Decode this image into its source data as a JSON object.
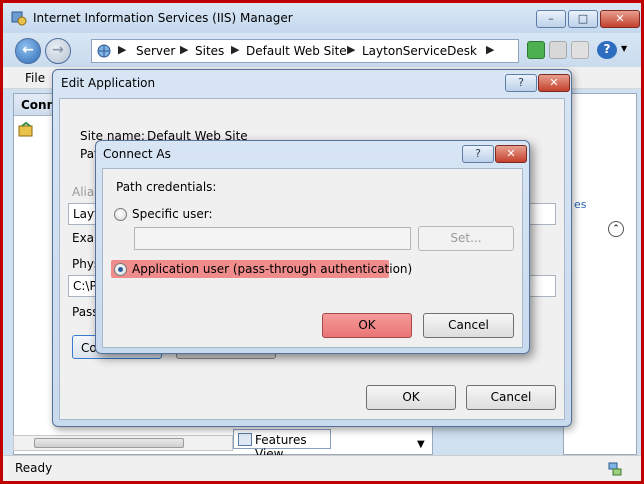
{
  "window": {
    "title": "Internet Information Services (IIS) Manager",
    "min_glyph": "–",
    "max_glyph": "□",
    "close_glyph": "✕"
  },
  "nav": {
    "back_glyph": "←",
    "forward_glyph": "→",
    "breadcrumb": [
      {
        "label": "Server"
      },
      {
        "label": "Sites"
      },
      {
        "label": "Default Web Site"
      },
      {
        "label": "LaytonServiceDesk"
      }
    ],
    "separator": "▶",
    "dropdown_glyph": "▼",
    "help_glyph": "?"
  },
  "menu": {
    "file": "File"
  },
  "connections": {
    "header": "Conne"
  },
  "features_tab": {
    "label": "Features View"
  },
  "right_pane": {
    "link": "es",
    "collapse_glyph": "⌃"
  },
  "status": {
    "text": "Ready"
  },
  "edit_dialog": {
    "title": "Edit Application",
    "help_glyph": "?",
    "close_glyph": "✕",
    "site_name_label": "Site name:",
    "site_name_value": "Default Web Site",
    "path_label": "Pat",
    "alias_label": "Alias",
    "field_layton": "Layt",
    "example_label": "Exam",
    "physical_label": "Phys",
    "physical_value": "C:\\P",
    "pass_label": "Pass",
    "connect_as_button": "Co",
    "ok": "OK",
    "cancel": "Cancel"
  },
  "connect_dialog": {
    "title": "Connect As",
    "help_glyph": "?",
    "close_glyph": "✕",
    "path_credentials_label": "Path credentials:",
    "specific_user_label": "Specific user:",
    "set_button": "Set...",
    "app_user_label": "Application user (pass-through authentication)",
    "selected_option": "application_user",
    "ok": "OK",
    "cancel": "Cancel"
  },
  "colors": {
    "window_border": "#c00000",
    "highlight": "#f08c8c",
    "ok_highlight": "#ea7575",
    "link": "#2a64b8"
  }
}
